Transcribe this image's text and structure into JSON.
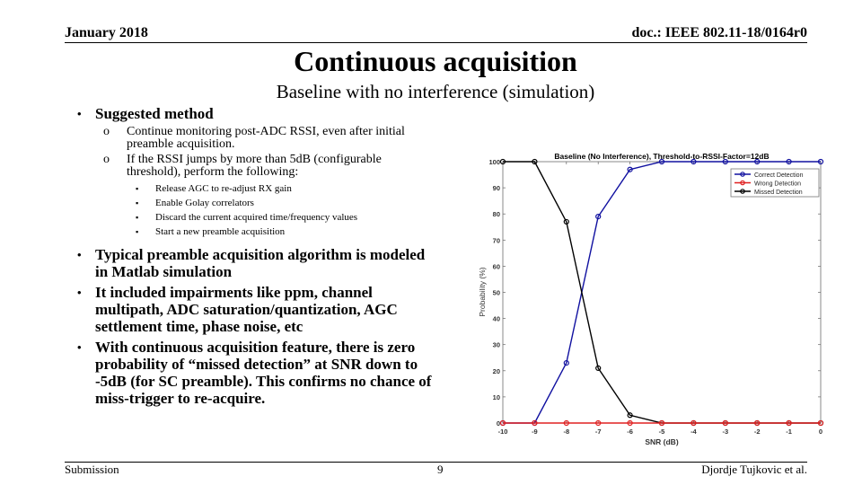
{
  "header": {
    "date": "January 2018",
    "doc_id": "doc.: IEEE 802.11-18/0164r0"
  },
  "slide": {
    "title": "Continuous acquisition",
    "subtitle": "Baseline with no interference (simulation)"
  },
  "bullets": {
    "suggested": {
      "label": "Suggested method",
      "items": [
        "Continue monitoring post-ADC RSSI, even after initial preamble acquisition.",
        "If the RSSI jumps by more than 5dB (configurable threshold), perform the following:"
      ],
      "subitems": [
        "Release AGC to re-adjust RX gain",
        "Enable Golay correlators",
        "Discard the current acquired time/frequency values",
        "Start a new preamble acquisition"
      ]
    },
    "main": [
      "Typical preamble acquisition algorithm is modeled in Matlab simulation",
      "It included impairments like ppm, channel multipath, ADC saturation/quantization, AGC settlement time, phase noise, etc",
      "With continuous acquisition feature, there is zero probability of “missed detection” at SNR down to -5dB (for SC preamble). This confirms no chance of miss-trigger to re-acquire."
    ],
    "markers": {
      "bullet": "•",
      "circle": "o",
      "square": "▪"
    }
  },
  "footer": {
    "left": "Submission",
    "page": "9",
    "author": "Djordje Tujkovic et al."
  },
  "chart_data": {
    "type": "line",
    "title": "Baseline (No Interference), Threshold-to-RSSI-Factor=12dB",
    "xlabel": "SNR (dB)",
    "ylabel": "Probability (%)",
    "x": [
      -10,
      -9,
      -8,
      -7,
      -6,
      -5,
      -4,
      -3,
      -2,
      -1,
      0
    ],
    "xlim": [
      -10,
      0
    ],
    "ylim": [
      0,
      100
    ],
    "xticks": [
      "-10",
      "-9",
      "-8",
      "-7",
      "-6",
      "-5",
      "-4",
      "-3",
      "-2",
      "-1",
      "0"
    ],
    "yticks": [
      "0",
      "10",
      "20",
      "30",
      "40",
      "50",
      "60",
      "70",
      "80",
      "90",
      "100"
    ],
    "legend_position": "top-right",
    "series": [
      {
        "name": "Correct Detection",
        "color": "#1010a0",
        "values": [
          0,
          0,
          23,
          79,
          97,
          100,
          100,
          100,
          100,
          100,
          100
        ]
      },
      {
        "name": "Wrong Detection",
        "color": "#e02020",
        "values": [
          0,
          0,
          0,
          0,
          0,
          0,
          0,
          0,
          0,
          0,
          0
        ]
      },
      {
        "name": "Missed Detection",
        "color": "#000000",
        "values": [
          100,
          100,
          77,
          21,
          3,
          0,
          0,
          0,
          0,
          0,
          0
        ]
      }
    ]
  }
}
